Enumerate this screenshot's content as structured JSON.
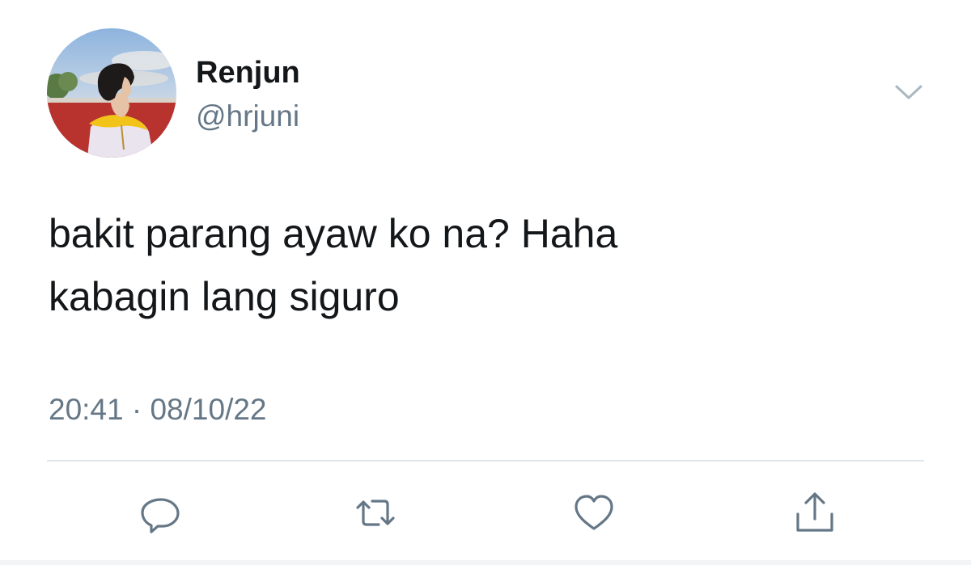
{
  "user": {
    "display_name": "Renjun",
    "handle": "@hrjuni"
  },
  "tweet": {
    "lines": [
      "bakit parang ayaw ko na? Haha",
      "kabagin lang siguro"
    ],
    "time": "20:41",
    "separator": "·",
    "date": "08/10/22"
  },
  "icons": {
    "menu": "chevron-down-icon",
    "reply": "reply-icon",
    "retweet": "retweet-icon",
    "like": "heart-icon",
    "share": "share-icon"
  },
  "colors": {
    "text": "#14171a",
    "secondary": "#657786",
    "icon": "#657786",
    "divider": "#e1e8ed"
  }
}
